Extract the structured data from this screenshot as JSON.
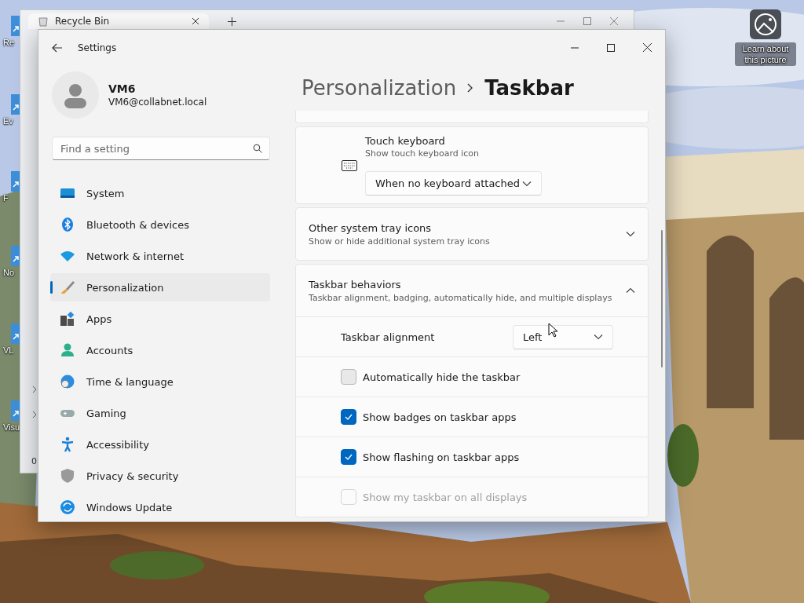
{
  "desktop": {
    "icons": [
      {
        "label": "Re"
      },
      {
        "label": "Ev"
      },
      {
        "label": "F"
      },
      {
        "label": "No"
      },
      {
        "label": "VL"
      },
      {
        "label": "Visu"
      }
    ],
    "spotlight": {
      "label": "Learn about this picture"
    }
  },
  "background_window": {
    "tab_title": "Recycle Bin",
    "status": "0"
  },
  "settings": {
    "title": "Settings",
    "user": {
      "name": "VM6",
      "email": "VM6@collabnet.local"
    },
    "search": {
      "placeholder": "Find a setting"
    },
    "nav": [
      {
        "label": "System",
        "selected": false
      },
      {
        "label": "Bluetooth & devices",
        "selected": false
      },
      {
        "label": "Network & internet",
        "selected": false
      },
      {
        "label": "Personalization",
        "selected": true
      },
      {
        "label": "Apps",
        "selected": false
      },
      {
        "label": "Accounts",
        "selected": false
      },
      {
        "label": "Time & language",
        "selected": false
      },
      {
        "label": "Gaming",
        "selected": false
      },
      {
        "label": "Accessibility",
        "selected": false
      },
      {
        "label": "Privacy & security",
        "selected": false
      },
      {
        "label": "Windows Update",
        "selected": false
      }
    ],
    "breadcrumb": {
      "parent": "Personalization",
      "current": "Taskbar"
    },
    "touch_keyboard": {
      "title": "Touch keyboard",
      "subtitle": "Show touch keyboard icon",
      "value": "When no keyboard attached"
    },
    "sections": [
      {
        "title": "Other system tray icons",
        "subtitle": "Show or hide additional system tray icons",
        "expanded": false
      },
      {
        "title": "Taskbar behaviors",
        "subtitle": "Taskbar alignment, badging, automatically hide, and multiple displays",
        "expanded": true
      }
    ],
    "behavior_rows": [
      {
        "kind": "dropdown",
        "label": "Taskbar alignment",
        "value": "Left"
      },
      {
        "kind": "checkbox",
        "label": "Automatically hide the taskbar",
        "checked": false,
        "disabled": false
      },
      {
        "kind": "checkbox",
        "label": "Show badges on taskbar apps",
        "checked": true,
        "disabled": false
      },
      {
        "kind": "checkbox",
        "label": "Show flashing on taskbar apps",
        "checked": true,
        "disabled": false
      },
      {
        "kind": "checkbox",
        "label": "Show my taskbar on all displays",
        "checked": false,
        "disabled": true
      }
    ]
  }
}
